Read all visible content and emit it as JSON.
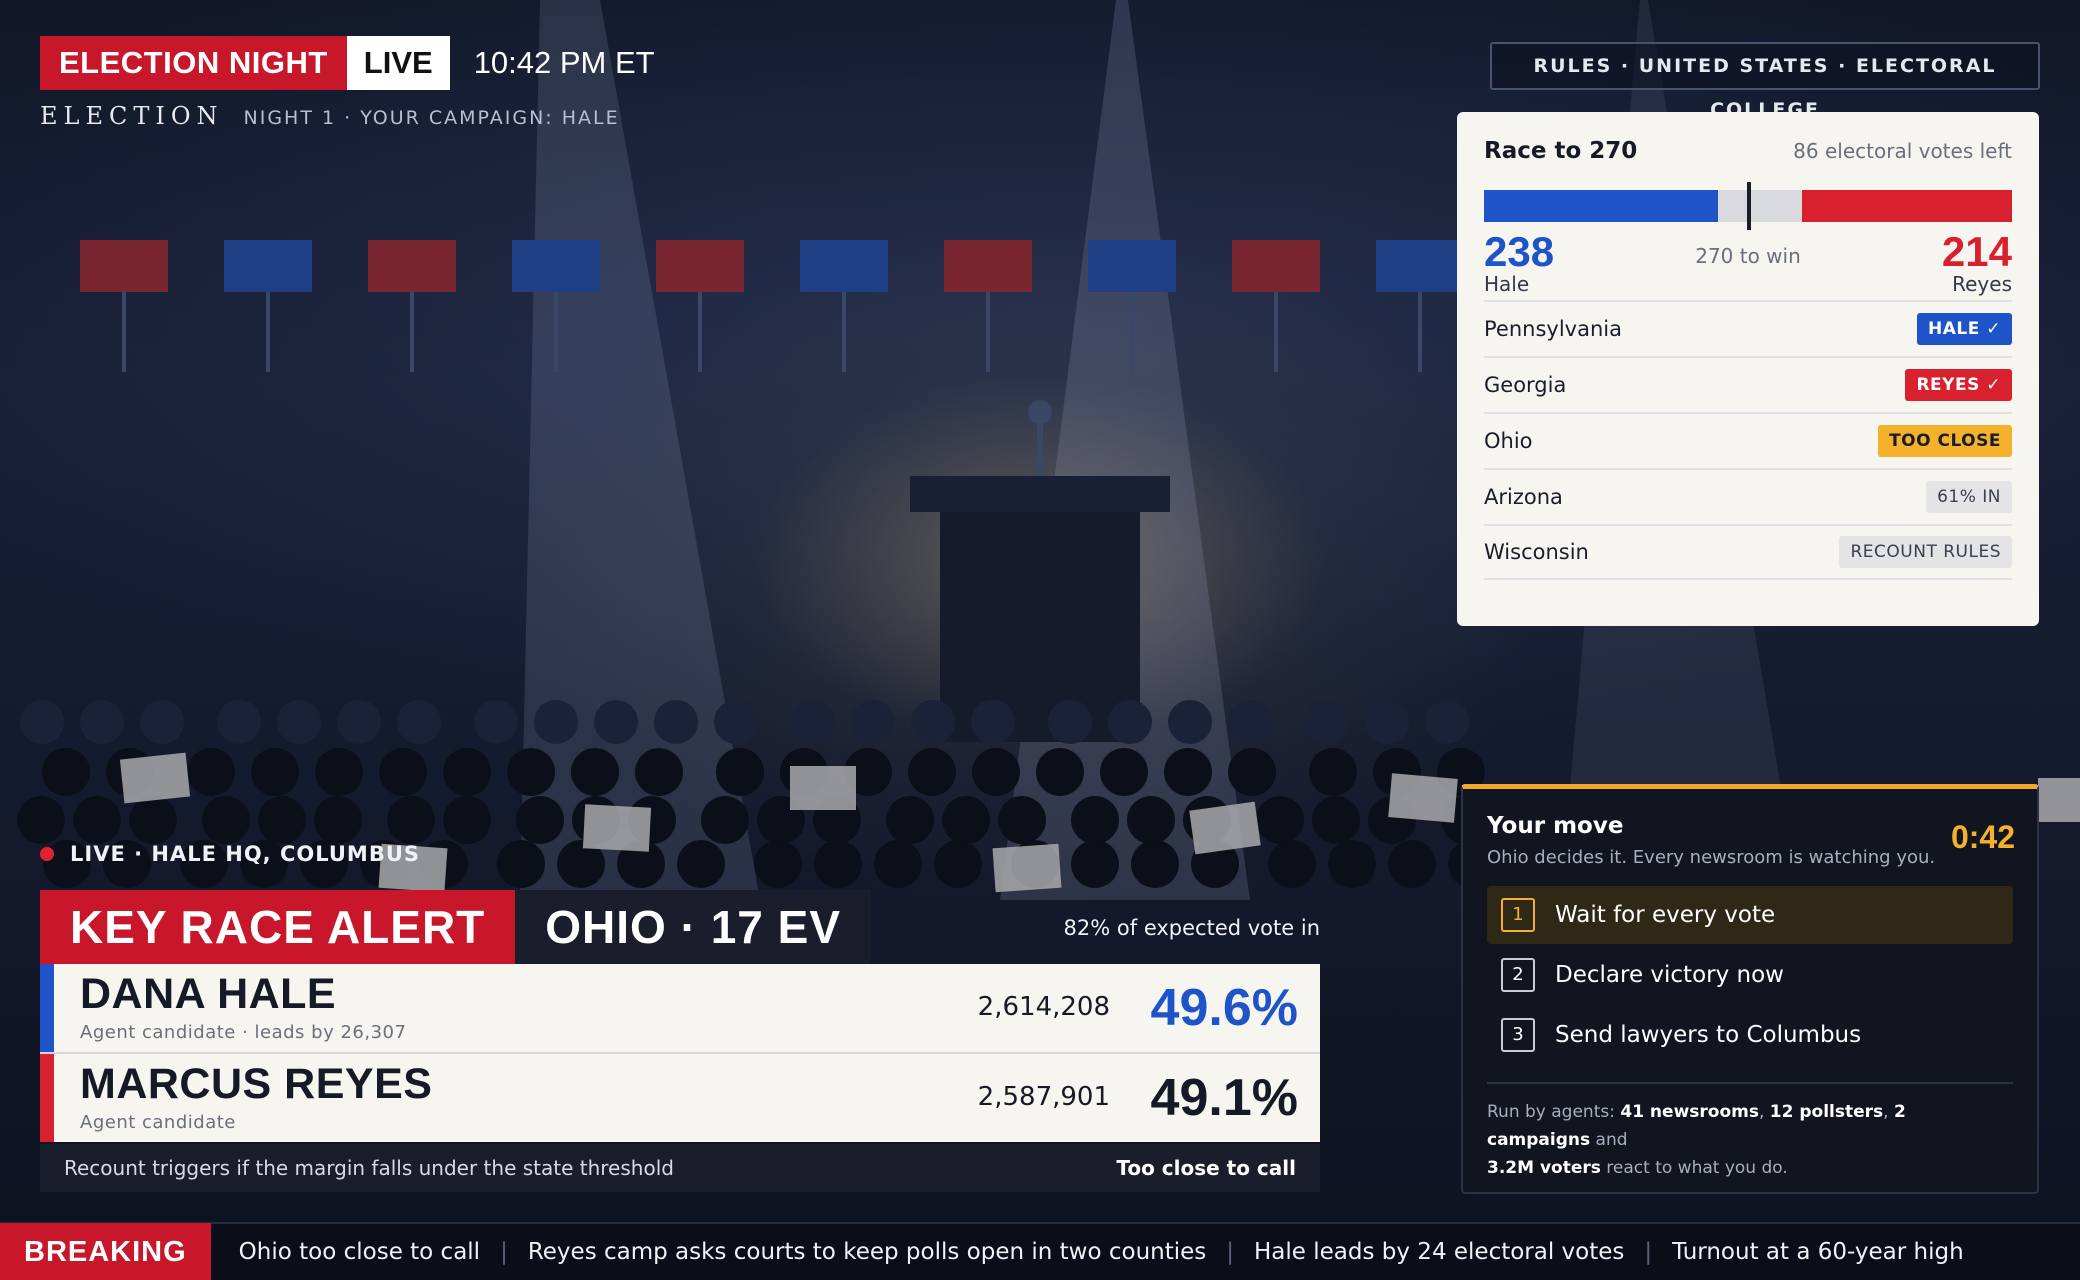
{
  "header": {
    "badge_election_night": "ELECTION NIGHT",
    "badge_live": "LIVE",
    "clock": "10:42 PM ET",
    "logo": "ELECTION",
    "subtitle": "NIGHT 1 · YOUR CAMPAIGN: HALE",
    "rules_button": "RULES · UNITED STATES · ELECTORAL COLLEGE"
  },
  "race": {
    "title": "Race to 270",
    "votes_left": "86 electoral votes left",
    "to_win": "270 to win",
    "total_ev": 538,
    "win_threshold": 270,
    "hale": {
      "ev": "238",
      "name": "Hale",
      "color": "#1f54c8"
    },
    "reyes": {
      "ev": "214",
      "name": "Reyes",
      "color": "#d8202e"
    },
    "states": [
      {
        "name": "Pennsylvania",
        "status": "HALE ✓",
        "style": "blue"
      },
      {
        "name": "Georgia",
        "status": "REYES ✓",
        "style": "red"
      },
      {
        "name": "Ohio",
        "status": "TOO CLOSE",
        "style": "yellow"
      },
      {
        "name": "Arizona",
        "status": "61% IN",
        "style": "grey"
      },
      {
        "name": "Wisconsin",
        "status": "RECOUNT RULES",
        "style": "grey"
      }
    ]
  },
  "live_feed": {
    "label": "LIVE · HALE HQ, COLUMBUS"
  },
  "alert": {
    "tag": "KEY RACE ALERT",
    "state": "OHIO · 17 EV",
    "expected": "82% of expected vote in",
    "candidates": [
      {
        "name": "DANA HALE",
        "sub": "Agent candidate · leads by 26,307",
        "votes": "2,614,208",
        "pct": "49.6%",
        "color": "#1f54c8",
        "pct_color": "#1f54c8"
      },
      {
        "name": "MARCUS REYES",
        "sub": "Agent candidate",
        "votes": "2,587,901",
        "pct": "49.1%",
        "color": "#d8202e",
        "pct_color": "#161a26"
      }
    ],
    "footer_note": "Recount triggers if the margin falls under the state threshold",
    "footer_status": "Too close to call"
  },
  "move": {
    "title": "Your move",
    "timer": "0:42",
    "subtitle": "Ohio decides it. Every newsroom is watching you.",
    "choices": [
      {
        "num": "1",
        "label": "Wait for every vote"
      },
      {
        "num": "2",
        "label": "Declare victory now"
      },
      {
        "num": "3",
        "label": "Send lawyers to Columbus"
      }
    ],
    "footer_prefix": "Run by agents:",
    "newsrooms": "41 newsrooms",
    "pollsters": "12 pollsters",
    "campaigns": "2 campaigns",
    "and_text": "and",
    "voters": "3.2M voters",
    "footer_suffix": "react to what you do."
  },
  "ticker": {
    "tag": "BREAKING",
    "items": [
      "Ohio too close to call",
      "Reyes camp asks courts to keep polls open in two counties",
      "Hale leads by 24 electoral votes",
      "Turnout at a 60-year high"
    ]
  }
}
